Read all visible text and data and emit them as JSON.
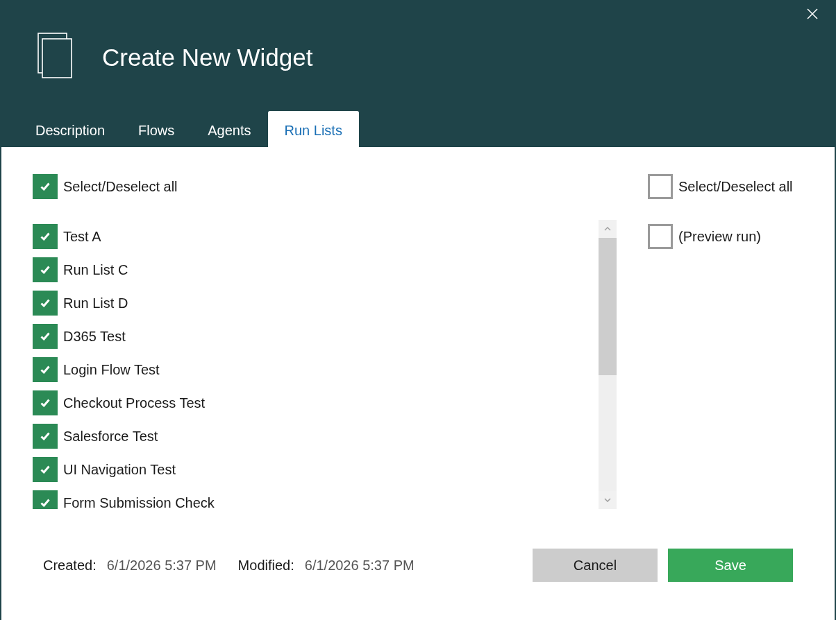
{
  "window": {
    "title": "Create New Widget"
  },
  "tabs": [
    {
      "label": "Description",
      "selected": false
    },
    {
      "label": "Flows",
      "selected": false
    },
    {
      "label": "Agents",
      "selected": false
    },
    {
      "label": "Run Lists",
      "selected": true
    }
  ],
  "run_lists": {
    "select_all": {
      "label": "Select/Deselect all",
      "checked": true
    },
    "items": [
      {
        "label": "Test A",
        "checked": true
      },
      {
        "label": "Run List C",
        "checked": true
      },
      {
        "label": "Run List D",
        "checked": true
      },
      {
        "label": "D365 Test",
        "checked": true
      },
      {
        "label": "Login Flow Test",
        "checked": true
      },
      {
        "label": "Checkout Process Test",
        "checked": true
      },
      {
        "label": "Salesforce Test",
        "checked": true
      },
      {
        "label": "UI Navigation Test",
        "checked": true
      },
      {
        "label": "Form Submission Check",
        "checked": true
      }
    ]
  },
  "options": [
    {
      "label": "Select/Deselect all",
      "checked": false
    },
    {
      "label": "(Preview run)",
      "checked": false
    }
  ],
  "footer": {
    "created": {
      "label": "Created:",
      "value": "6/1/2026 5:37 PM"
    },
    "modified": {
      "label": "Modified:",
      "value": "6/1/2026 5:37 PM"
    }
  },
  "buttons": [
    {
      "label": "Cancel",
      "kind": "secondary"
    },
    {
      "label": "Save",
      "kind": "primary"
    }
  ]
}
